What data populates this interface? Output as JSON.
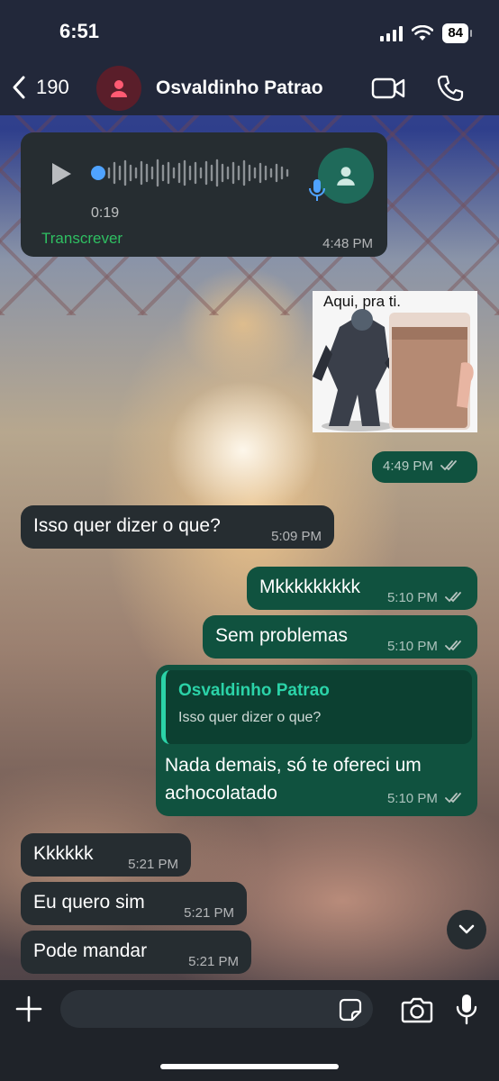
{
  "status_bar": {
    "time": "6:51",
    "battery": "84"
  },
  "header": {
    "back_count": "190",
    "contact_name": "Osvaldinho Patrao"
  },
  "messages": {
    "voice": {
      "duration": "0:19",
      "transcribe_label": "Transcrever",
      "time": "4:48 PM"
    },
    "sticker": {
      "caption": "Aqui, pra ti.",
      "time": "4:49 PM"
    },
    "m1": {
      "text": "Isso quer dizer o que?",
      "time": "5:09 PM"
    },
    "m2": {
      "text": "Mkkkkkkkkk",
      "time": "5:10 PM"
    },
    "m3": {
      "text": "Sem problemas",
      "time": "5:10 PM"
    },
    "m4": {
      "quoted_author": "Osvaldinho Patrao",
      "quoted_text": "Isso quer dizer o que?",
      "text": "Nada demais, só te ofereci um achocolatado",
      "time": "5:10 PM"
    },
    "m5": {
      "text": "Kkkkkk",
      "time": "5:21 PM"
    },
    "m6": {
      "text": "Eu quero sim",
      "time": "5:21 PM"
    },
    "m7": {
      "text": "Pode mandar",
      "time": "5:21 PM"
    }
  },
  "colors": {
    "incoming": "#262d31",
    "outgoing": "#10523f",
    "accent_green": "#2fbf62",
    "quote_accent": "#2bd3a8"
  },
  "composer": {
    "placeholder": ""
  }
}
